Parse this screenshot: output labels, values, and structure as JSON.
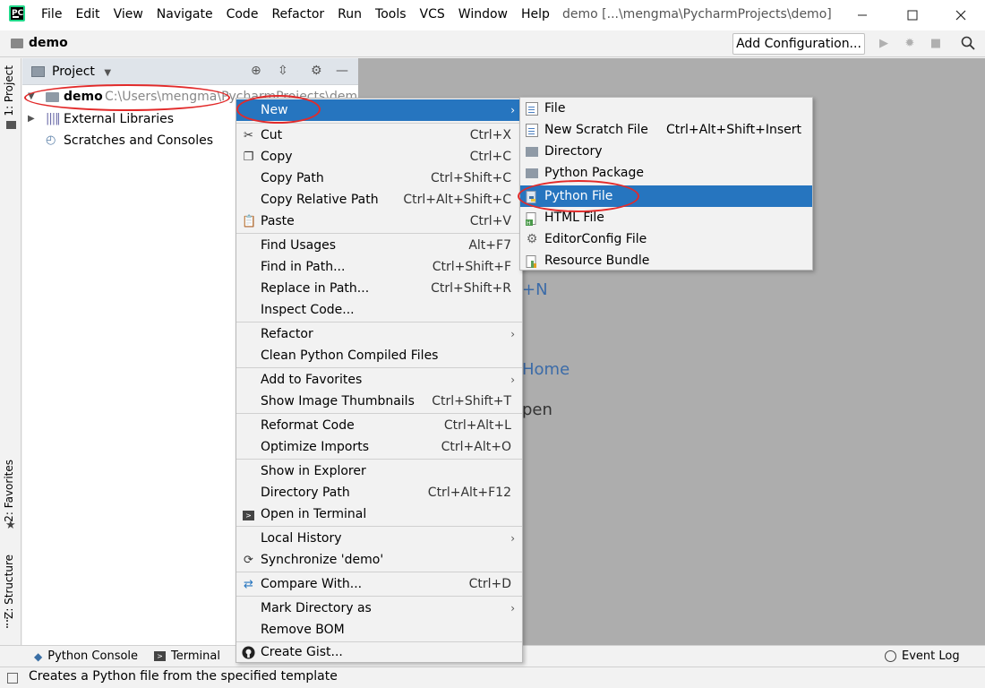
{
  "menubar": {
    "items": [
      "File",
      "Edit",
      "View",
      "Navigate",
      "Code",
      "Refactor",
      "Run",
      "Tools",
      "VCS",
      "Window",
      "Help"
    ]
  },
  "window": {
    "title": "demo [...\\mengma\\PycharmProjects\\demo]"
  },
  "navbar": {
    "project_name": "demo",
    "add_config_label": "Add Configuration..."
  },
  "left_strip": {
    "project_tab": "1: Project",
    "favorites_tab": "2: Favorites",
    "structure_tab": "Z: Structure"
  },
  "project_panel": {
    "title": "Project",
    "root_name": "demo",
    "root_path": "C:\\Users\\mengma\\PycharmProjects\\demo",
    "external_libraries": "External Libraries",
    "scratches": "Scratches and Consoles"
  },
  "editor_hints": {
    "hint1": "+N",
    "hint2": "Home",
    "hint3": "pen"
  },
  "context_menu": {
    "new": "New",
    "cut": "Cut",
    "cut_sc": "Ctrl+X",
    "copy": "Copy",
    "copy_sc": "Ctrl+C",
    "copy_path": "Copy Path",
    "copy_path_sc": "Ctrl+Shift+C",
    "copy_rel": "Copy Relative Path",
    "copy_rel_sc": "Ctrl+Alt+Shift+C",
    "paste": "Paste",
    "paste_sc": "Ctrl+V",
    "find_usages": "Find Usages",
    "find_usages_sc": "Alt+F7",
    "find_in_path": "Find in Path...",
    "find_in_path_sc": "Ctrl+Shift+F",
    "replace_in_path": "Replace in Path...",
    "replace_in_path_sc": "Ctrl+Shift+R",
    "inspect": "Inspect Code...",
    "refactor": "Refactor",
    "clean_py": "Clean Python Compiled Files",
    "add_fav": "Add to Favorites",
    "show_thumbs": "Show Image Thumbnails",
    "show_thumbs_sc": "Ctrl+Shift+T",
    "reformat": "Reformat Code",
    "reformat_sc": "Ctrl+Alt+L",
    "optimize": "Optimize Imports",
    "optimize_sc": "Ctrl+Alt+O",
    "show_explorer": "Show in Explorer",
    "dir_path": "Directory Path",
    "dir_path_sc": "Ctrl+Alt+F12",
    "open_terminal": "Open in Terminal",
    "local_history": "Local History",
    "sync": "Synchronize 'demo'",
    "compare": "Compare With...",
    "compare_sc": "Ctrl+D",
    "mark_dir": "Mark Directory as",
    "remove_bom": "Remove BOM",
    "create_gist": "Create Gist..."
  },
  "sub_menu": {
    "file": "File",
    "scratch": "New Scratch File",
    "scratch_sc": "Ctrl+Alt+Shift+Insert",
    "directory": "Directory",
    "py_package": "Python Package",
    "py_file": "Python File",
    "html_file": "HTML File",
    "editorconfig": "EditorConfig File",
    "resource_bundle": "Resource Bundle"
  },
  "bottom_strip": {
    "python_console": "Python Console",
    "terminal": "Terminal",
    "event_log": "Event Log"
  },
  "status_bar": {
    "message": "Creates a Python file from the specified template"
  },
  "colors": {
    "selection": "#2675bf",
    "annotation": "#e22a2a",
    "editor_bg": "#adadad"
  }
}
